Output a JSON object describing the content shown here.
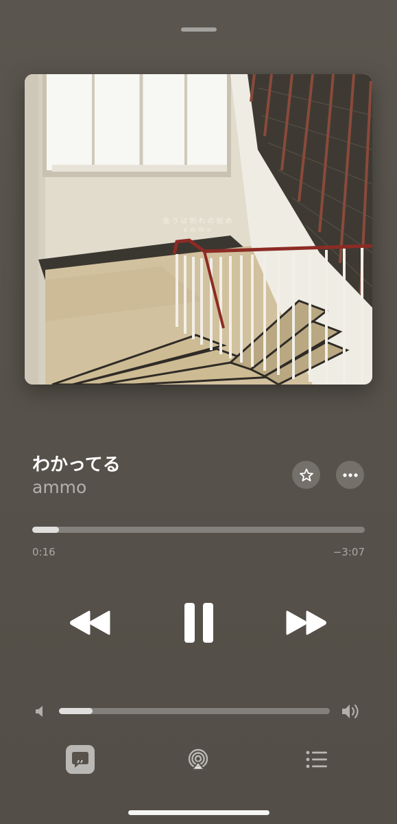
{
  "album": {
    "art_title": "会うは別れの始め",
    "art_artist": "ammo"
  },
  "track": {
    "title": "わかってる",
    "artist": "ammo"
  },
  "playback": {
    "elapsed": "0:16",
    "remaining": "−3:07",
    "progress_fraction": 0.08,
    "state": "playing"
  },
  "volume": {
    "level_fraction": 0.125
  },
  "icons": {
    "favorite": "star-icon",
    "more": "ellipsis-icon",
    "rewind": "backward-icon",
    "pause": "pause-icon",
    "forward": "forward-icon",
    "volume_low": "speaker-low-icon",
    "volume_high": "speaker-high-icon",
    "lyrics": "quote-bubble-icon",
    "airplay": "airplay-icon",
    "queue": "list-icon"
  },
  "colors": {
    "background": "#57524b",
    "handrail": "#8c2b24"
  }
}
